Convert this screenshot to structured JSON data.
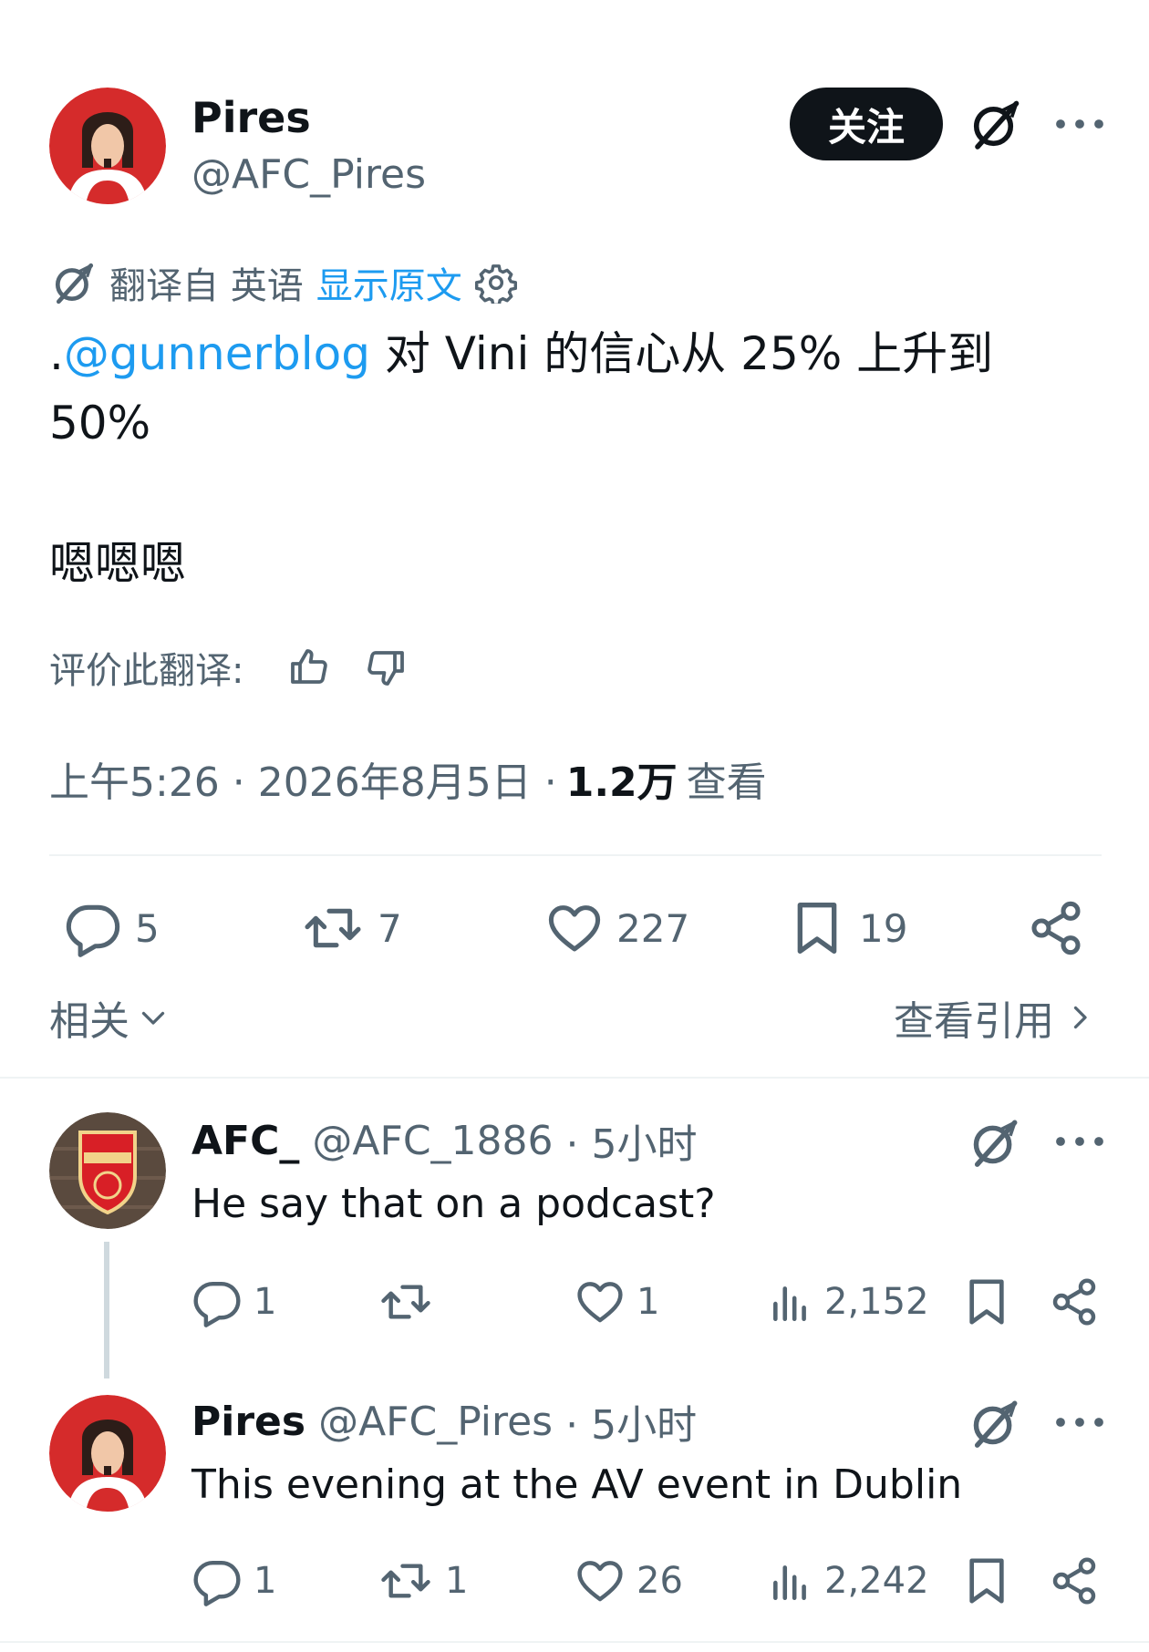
{
  "tweet": {
    "author_name": "Pires",
    "author_handle": "@AFC_Pires",
    "follow_label": "关注",
    "translation": {
      "translated_from": "翻译自 英语",
      "show_original": "显示原文"
    },
    "text_prefix": ".",
    "mention": "@gunnerblog",
    "text_line1": " 对 Vini 的信心从 25% 上升到",
    "text_line2": "50%",
    "text_line3": "嗯嗯嗯",
    "rate_label": "评价此翻译:",
    "time": "上午5:26 · 2026年8月5日 ·",
    "views_count": "1.2万",
    "views_label": "查看",
    "stats": {
      "replies": "5",
      "retweets": "7",
      "likes": "227",
      "bookmarks": "19"
    },
    "related_label": "相关",
    "quotes_label": "查看引用"
  },
  "replies": [
    {
      "name": "AFC_",
      "handle": "@AFC_1886",
      "time": "· 5小时",
      "text": "He say that on a podcast?",
      "replies": "1",
      "retweets": "",
      "likes": "1",
      "views": "2,152"
    },
    {
      "name": "Pires",
      "handle": "@AFC_Pires",
      "time": "· 5小时",
      "text": "This evening at the AV event in Dublin",
      "replies": "1",
      "retweets": "1",
      "likes": "26",
      "views": "2,242"
    }
  ],
  "colors": {
    "text": "#0f1419",
    "muted": "#536471",
    "link": "#1d9bf0",
    "divider": "#eff3f4"
  },
  "icons": [
    "grok-icon",
    "more-icon",
    "settings-icon",
    "thumbs-up-icon",
    "thumbs-down-icon",
    "reply-icon",
    "retweet-icon",
    "like-icon",
    "bookmark-icon",
    "share-icon",
    "views-icon",
    "chevron-down-icon",
    "chevron-right-icon"
  ]
}
